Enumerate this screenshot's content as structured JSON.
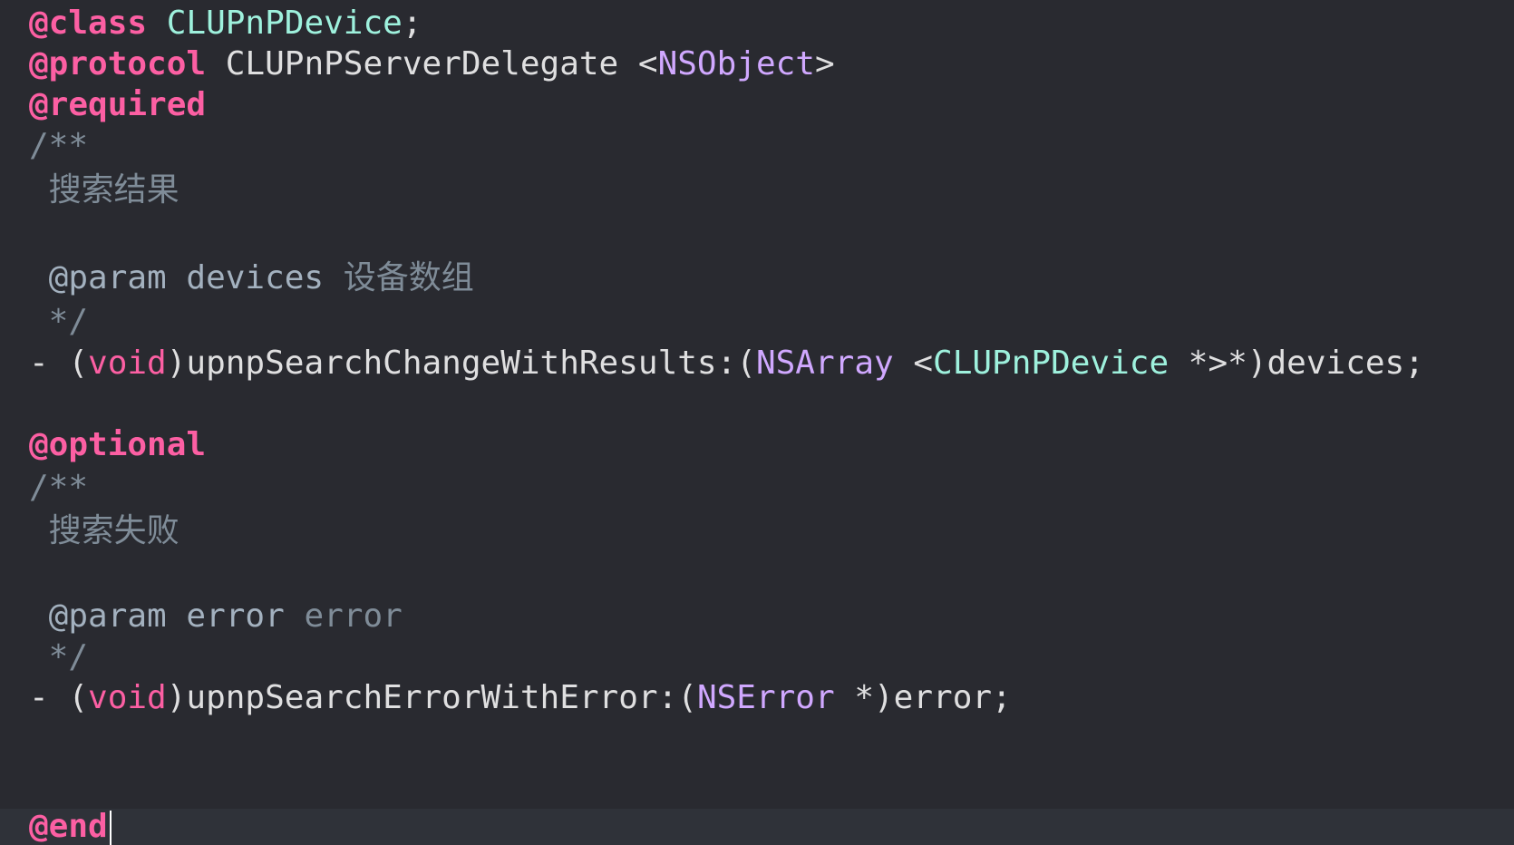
{
  "editor": {
    "lines": [
      [
        "@class",
        " ",
        "CLUPnPDevice",
        ";"
      ],
      [
        "@protocol",
        " CLUPnPServerDelegate <",
        "NSObject",
        ">"
      ],
      [
        "@required"
      ],
      [
        "/**"
      ],
      [
        " 搜索结果"
      ],
      [
        ""
      ],
      [
        " @param",
        " devices",
        " 设备数组"
      ],
      [
        " */"
      ],
      [
        "- (",
        "void",
        ")upnpSearchChangeWithResults:(",
        "NSArray",
        " <",
        "CLUPnPDevice",
        " *>*)devices;"
      ],
      [
        ""
      ],
      [
        "@optional"
      ],
      [
        "/**"
      ],
      [
        " 搜索失败"
      ],
      [
        ""
      ],
      [
        " @param",
        " error",
        " error"
      ],
      [
        " */"
      ],
      [
        "- (",
        "void",
        ")upnpSearchErrorWithError:(",
        "NSError",
        " *)error;"
      ],
      [
        ""
      ],
      [
        "@end"
      ]
    ]
  },
  "colors": {
    "background": "#292a30",
    "current_line": "#2f3239",
    "keyword": "#fc5fa3",
    "project_type": "#9ef1dd",
    "system_type": "#d0a8ff",
    "plain": "#dfdfe0",
    "comment": "#7f8c98"
  }
}
